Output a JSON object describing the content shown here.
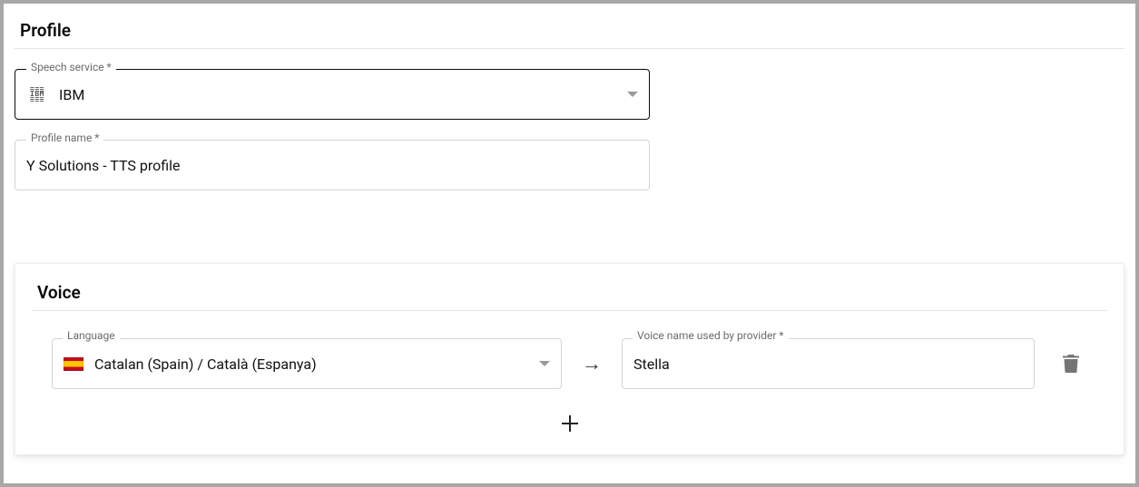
{
  "profile": {
    "section_title": "Profile",
    "speech_service": {
      "label": "Speech service *",
      "value": "IBM",
      "provider_icon": "ibm-logo"
    },
    "profile_name": {
      "label": "Profile name *",
      "value": "Y Solutions - TTS profile"
    }
  },
  "voice": {
    "section_title": "Voice",
    "rows": [
      {
        "language": {
          "label": "Language",
          "value": "Catalan (Spain) / Català (Espanya)",
          "flag": "es"
        },
        "voice_name": {
          "label": "Voice name used by provider *",
          "value": "Stella"
        }
      }
    ]
  }
}
